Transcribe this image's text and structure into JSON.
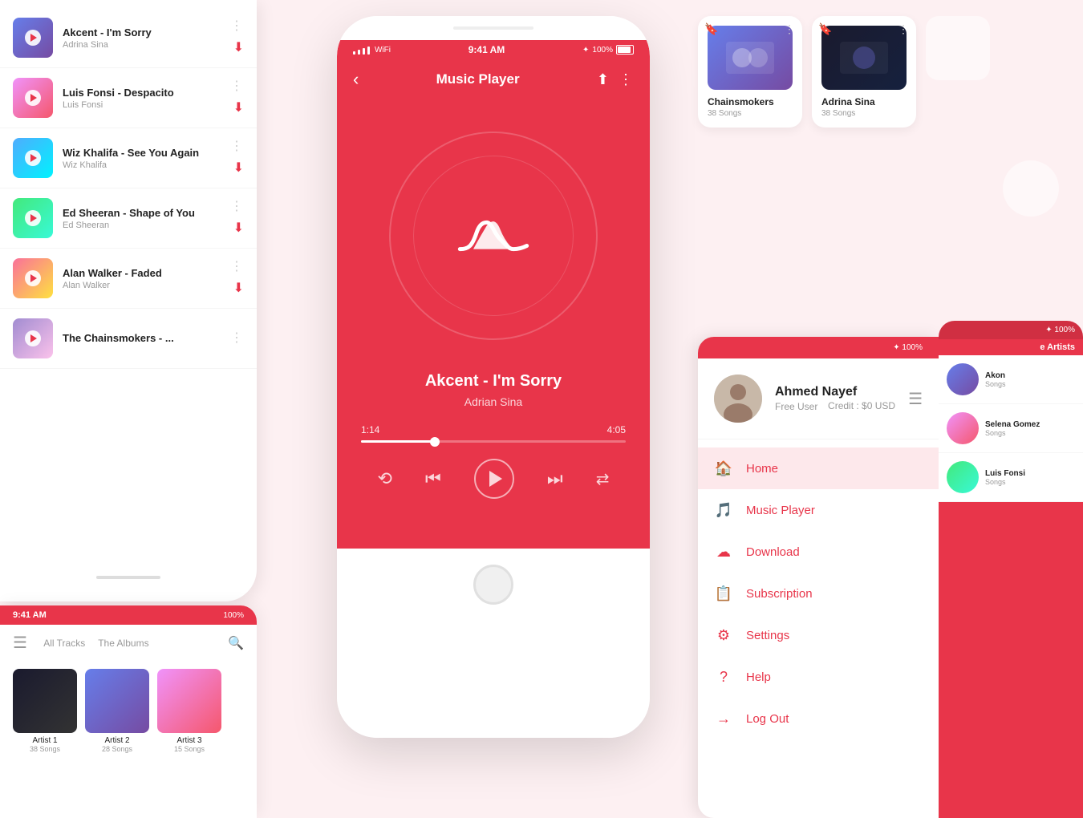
{
  "app": {
    "name": "Music Player",
    "accent_color": "#e8354a",
    "bg_color": "#fdf0f2"
  },
  "status_bar": {
    "time": "9:41 AM",
    "battery": "100%",
    "signal": "●●●●"
  },
  "center_player": {
    "title": "Music Player",
    "back_label": "‹",
    "song_title": "Akcent - I'm Sorry",
    "song_artist": "Adrian Sina",
    "current_time": "1:14",
    "total_time": "4:05",
    "progress_pct": 28
  },
  "song_list": [
    {
      "title": "Akcent - I'm Sorry",
      "artist": "Adrina Sina",
      "thumb_class": "thumb-1"
    },
    {
      "title": "Luis Fonsi - Despacito",
      "artist": "Luis Fonsi",
      "thumb_class": "thumb-2"
    },
    {
      "title": "Wiz Khalifa - See You Again",
      "artist": "Wiz Khalifa",
      "thumb_class": "thumb-3"
    },
    {
      "title": "Ed Sheeran - Shape of You",
      "artist": "Ed Sheeran",
      "thumb_class": "thumb-4"
    },
    {
      "title": "Alan Walker - Faded",
      "artist": "Alan Walker",
      "thumb_class": "thumb-5"
    },
    {
      "title": "The Chainsmokers - ...",
      "artist": "",
      "thumb_class": "thumb-6"
    }
  ],
  "artist_tabs": [
    "All Tracks",
    "The Albums",
    "The Artists"
  ],
  "active_tab": "The Artists",
  "albums": [
    {
      "name": "Chainsmokers",
      "songs": "38 Songs"
    },
    {
      "name": "Adrina Sina",
      "songs": "38 Songs"
    }
  ],
  "sidebar": {
    "user": {
      "name": "Ahmed Nayef",
      "tier": "Free User",
      "credit": "Credit : $0 USD"
    },
    "menu_items": [
      {
        "icon": "🏠",
        "label": "Home",
        "active": true
      },
      {
        "icon": "🎵",
        "label": "Music Player",
        "active": false
      },
      {
        "icon": "☁",
        "label": "Download",
        "active": false
      },
      {
        "icon": "📋",
        "label": "Subscription",
        "active": false
      },
      {
        "icon": "⚙",
        "label": "Settings",
        "active": false
      },
      {
        "icon": "?",
        "label": "Help",
        "active": false
      },
      {
        "icon": "→",
        "label": "Log Out",
        "active": false
      }
    ]
  },
  "right_artists": [
    {
      "name": "Akon",
      "songs": "Songs"
    },
    {
      "name": "Selena Gomez",
      "songs": "Songs"
    },
    {
      "name": "Luis Fonsi",
      "songs": "Songs"
    }
  ]
}
